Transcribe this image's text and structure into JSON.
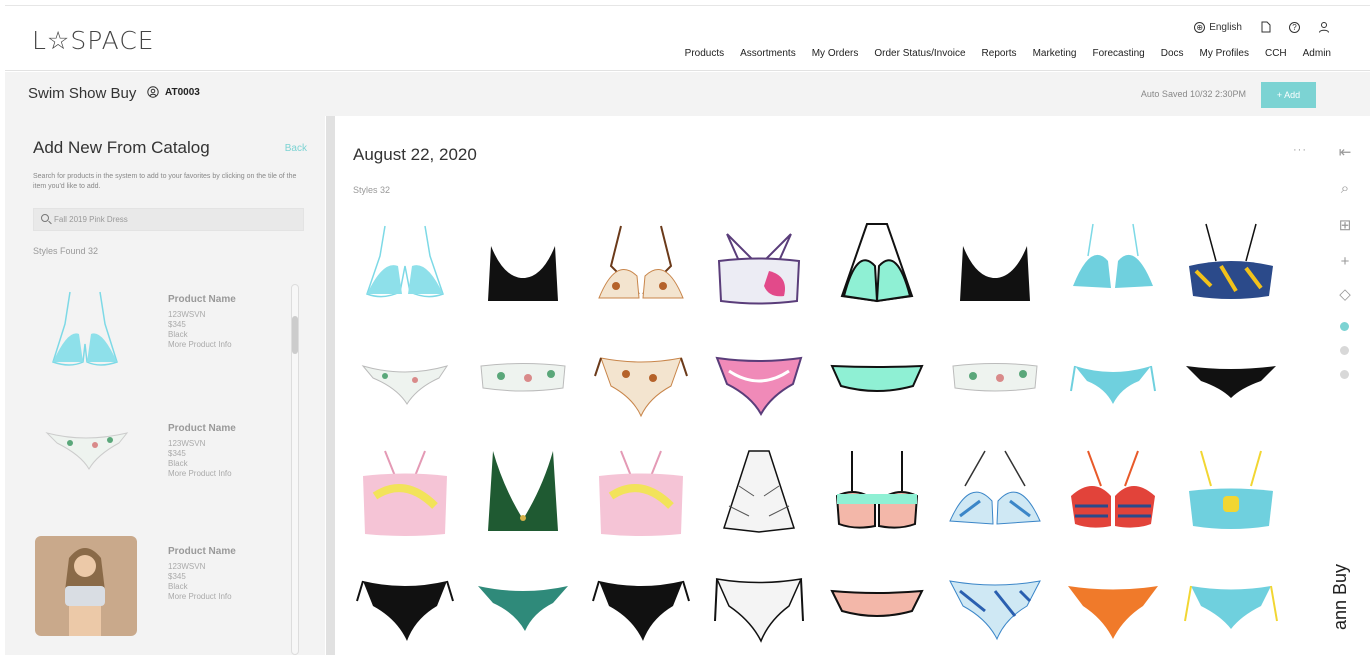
{
  "header": {
    "logo": "L☆SPACE",
    "language": "English",
    "nav": [
      "Products",
      "Assortments",
      "My Orders",
      "Order Status/Invoice",
      "Reports",
      "Marketing",
      "Forecasting",
      "Docs",
      "My Profiles",
      "CCH",
      "Admin"
    ]
  },
  "subbar": {
    "title": "Swim Show Buy",
    "account": "AT0003",
    "saved": "Auto Saved 10/32 2:30PM",
    "add_label": "+ Add"
  },
  "left": {
    "title": "Add New From Catalog",
    "back": "Back",
    "description": "Search for products in the system to add to your favorites by clicking on the tile of the item you'd like to add.",
    "search_placeholder": "Fall 2019 Pink Dress",
    "found": "Styles Found  32",
    "products": [
      {
        "name": "Product Name",
        "sku": "123WSVN",
        "price": "$345",
        "color": "Black",
        "more": "More Product Info"
      },
      {
        "name": "Product Name",
        "sku": "123WSVN",
        "price": "$345",
        "color": "Black",
        "more": "More Product Info"
      },
      {
        "name": "Product Name",
        "sku": "123WSVN",
        "price": "$345",
        "color": "Black",
        "more": "More Product Info"
      }
    ]
  },
  "main": {
    "date": "August 22, 2020",
    "styles": "Styles  32",
    "more": "···"
  },
  "side_text": "ann Buy",
  "colors": {
    "accent": "#7cd3d3",
    "panel": "#f3f3f3"
  }
}
